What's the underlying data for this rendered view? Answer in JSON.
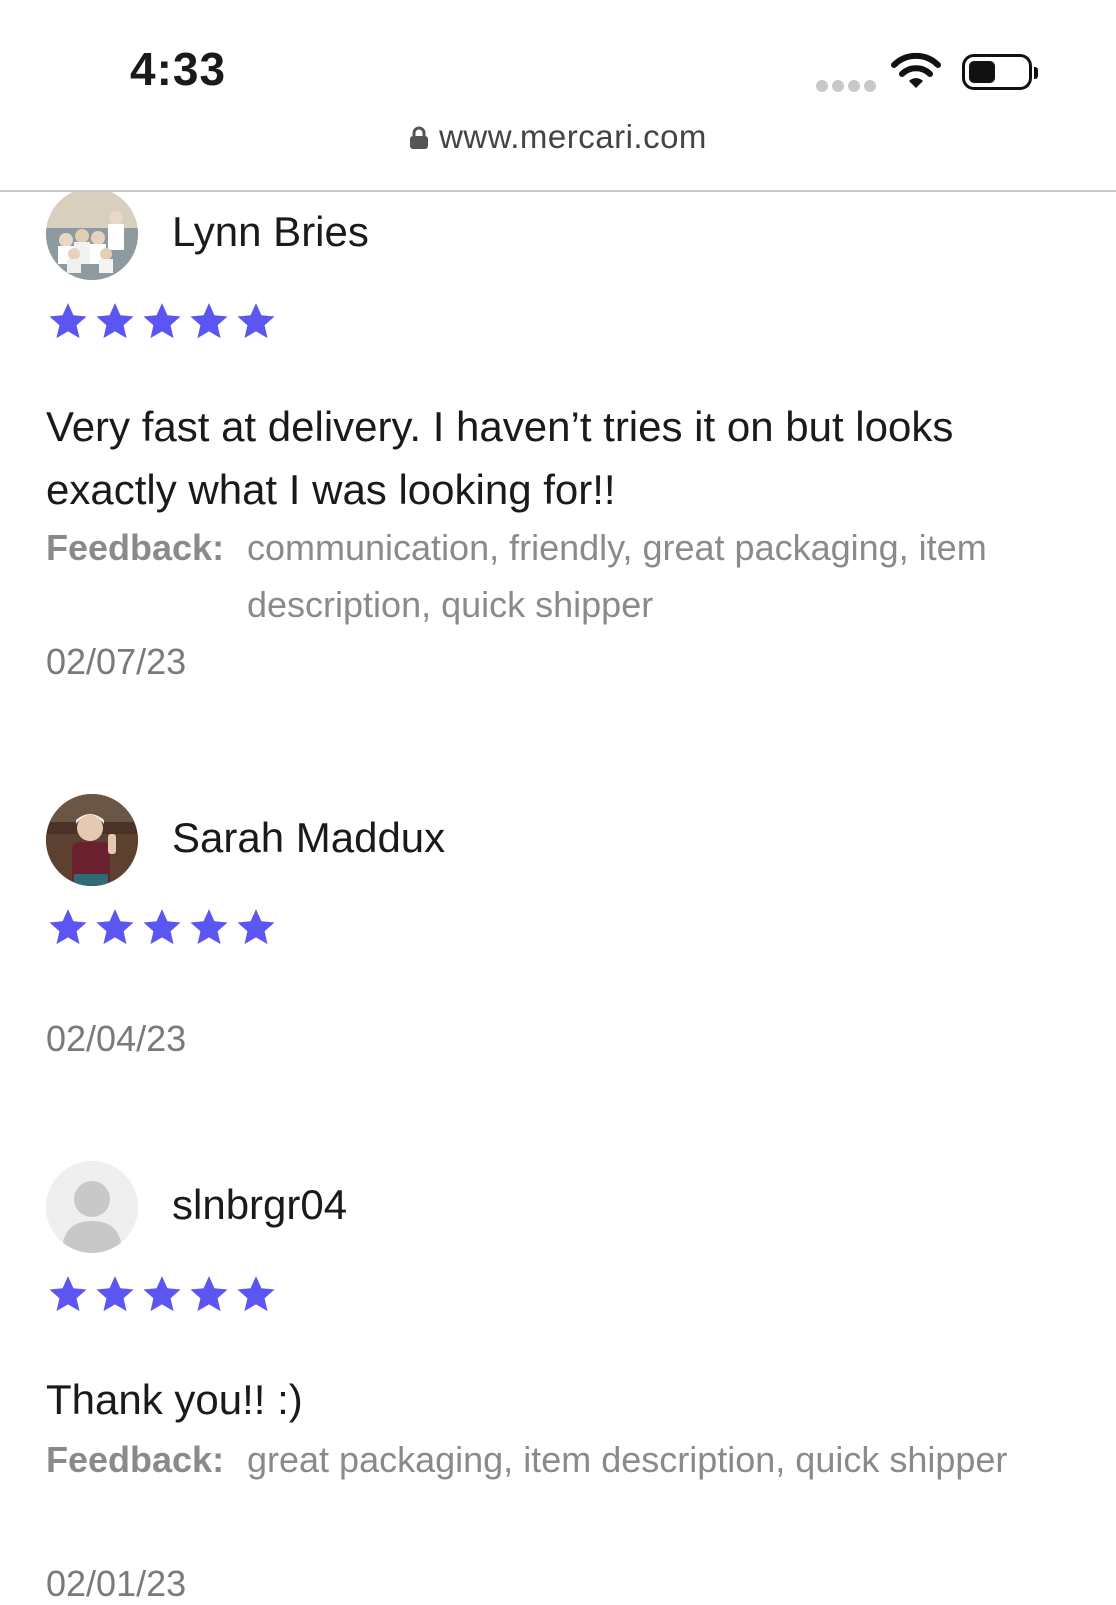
{
  "status_bar": {
    "time": "4:33",
    "url": "www.mercari.com"
  },
  "colors": {
    "star": "#5b55f2",
    "text": "#1a1a1a",
    "muted": "#8a8a8a"
  },
  "reviews": [
    {
      "name": "Lynn Bries",
      "rating": 5,
      "comment": "Very fast at delivery. I haven’t tries it on but looks exactly what I was looking for!!",
      "feedback_label": "Feedback:",
      "feedback": "communication, friendly, great packaging, item description, quick shipper",
      "date": "02/07/23",
      "avatar": "photo"
    },
    {
      "name": "Sarah Maddux",
      "rating": 5,
      "comment": "",
      "feedback_label": "",
      "feedback": "",
      "date": "02/04/23",
      "avatar": "photo"
    },
    {
      "name": "slnbrgr04",
      "rating": 5,
      "comment": "Thank you!! :)",
      "feedback_label": "Feedback:",
      "feedback": "great packaging, item description, quick shipper",
      "date": "02/01/23",
      "avatar": "default-user-icon"
    }
  ]
}
